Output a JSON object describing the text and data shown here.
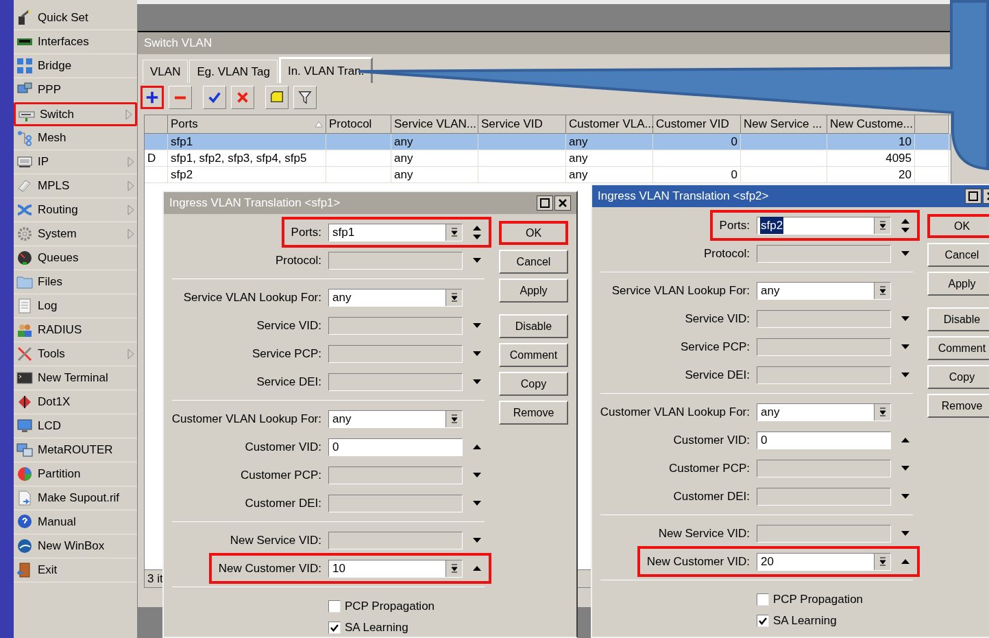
{
  "sidebar": {
    "items": [
      {
        "label": "Quick Set",
        "submenu": false,
        "highlighted": false
      },
      {
        "label": "Interfaces",
        "submenu": false,
        "highlighted": false
      },
      {
        "label": "Bridge",
        "submenu": false,
        "highlighted": false
      },
      {
        "label": "PPP",
        "submenu": false,
        "highlighted": false
      },
      {
        "label": "Switch",
        "submenu": true,
        "highlighted": true
      },
      {
        "label": "Mesh",
        "submenu": false,
        "highlighted": false
      },
      {
        "label": "IP",
        "submenu": true,
        "highlighted": false
      },
      {
        "label": "MPLS",
        "submenu": true,
        "highlighted": false
      },
      {
        "label": "Routing",
        "submenu": true,
        "highlighted": false
      },
      {
        "label": "System",
        "submenu": true,
        "highlighted": false
      },
      {
        "label": "Queues",
        "submenu": false,
        "highlighted": false
      },
      {
        "label": "Files",
        "submenu": false,
        "highlighted": false
      },
      {
        "label": "Log",
        "submenu": false,
        "highlighted": false
      },
      {
        "label": "RADIUS",
        "submenu": false,
        "highlighted": false
      },
      {
        "label": "Tools",
        "submenu": true,
        "highlighted": false
      },
      {
        "label": "New Terminal",
        "submenu": false,
        "highlighted": false
      },
      {
        "label": "Dot1X",
        "submenu": false,
        "highlighted": false
      },
      {
        "label": "LCD",
        "submenu": false,
        "highlighted": false
      },
      {
        "label": "MetaROUTER",
        "submenu": false,
        "highlighted": false
      },
      {
        "label": "Partition",
        "submenu": false,
        "highlighted": false
      },
      {
        "label": "Make Supout.rif",
        "submenu": false,
        "highlighted": false
      },
      {
        "label": "Manual",
        "submenu": false,
        "highlighted": false
      },
      {
        "label": "New WinBox",
        "submenu": false,
        "highlighted": false
      },
      {
        "label": "Exit",
        "submenu": false,
        "highlighted": false
      }
    ]
  },
  "window": {
    "title": "Switch VLAN",
    "tabs": [
      {
        "label": "VLAN",
        "selected": false,
        "highlighted": false
      },
      {
        "label": "Eg. VLAN Tag",
        "selected": false,
        "highlighted": false
      },
      {
        "label": "In. VLAN Tran.",
        "selected": true,
        "highlighted": true
      }
    ],
    "toolbar": [
      {
        "kind": "add",
        "highlighted": true
      },
      {
        "kind": "remove",
        "highlighted": false
      },
      {
        "kind": "enable",
        "highlighted": false
      },
      {
        "kind": "disable",
        "highlighted": false
      },
      {
        "kind": "comment",
        "highlighted": false
      },
      {
        "kind": "filter",
        "highlighted": false
      }
    ],
    "table": {
      "columns": [
        "",
        "Ports",
        "Protocol",
        "Service VLAN...",
        "Service VID",
        "Customer VLA...",
        "Customer VID",
        "New Service ...",
        "New Custome..."
      ],
      "rows": [
        {
          "selected": true,
          "cells": [
            "",
            "sfp1",
            "",
            "any",
            "",
            "any",
            "0",
            "",
            "10"
          ]
        },
        {
          "selected": false,
          "cells": [
            "D",
            "sfp1, sfp2, sfp3, sfp4, sfp5",
            "",
            "any",
            "",
            "any",
            "",
            "",
            "4095"
          ]
        },
        {
          "selected": false,
          "cells": [
            "",
            "sfp2",
            "",
            "any",
            "",
            "any",
            "0",
            "",
            "20"
          ]
        }
      ]
    },
    "status_bar": "3 it"
  },
  "dialogs": [
    {
      "title": "Ingress VLAN Translation <sfp1>",
      "active": false,
      "sections": [
        {
          "fields": [
            {
              "label": "Ports:",
              "value": "sfp1",
              "kind": "spin",
              "text_selected": false,
              "highlighted": true
            },
            {
              "label": "Protocol:",
              "kind": "select",
              "highlighted": false
            }
          ]
        },
        {
          "fields": [
            {
              "label": "Service VLAN Lookup For:",
              "value": "any",
              "kind": "combo",
              "text_selected": false,
              "highlighted": false
            },
            {
              "label": "Service VID:",
              "kind": "select",
              "highlighted": false
            },
            {
              "label": "Service PCP:",
              "kind": "select",
              "highlighted": false
            },
            {
              "label": "Service DEI:",
              "kind": "select",
              "highlighted": false
            }
          ]
        },
        {
          "fields": [
            {
              "label": "Customer VLAN Lookup For:",
              "value": "any",
              "kind": "combo",
              "text_selected": false,
              "highlighted": false
            },
            {
              "label": "Customer VID:",
              "value": "0",
              "kind": "counter",
              "text_selected": false,
              "highlighted": false
            },
            {
              "label": "Customer PCP:",
              "kind": "select",
              "highlighted": false
            },
            {
              "label": "Customer DEI:",
              "kind": "select",
              "highlighted": false
            }
          ]
        },
        {
          "fields": [
            {
              "label": "New Service VID:",
              "kind": "select",
              "highlighted": false
            },
            {
              "label": "New Customer VID:",
              "value": "10",
              "kind": "spinup",
              "text_selected": false,
              "highlighted": true
            }
          ]
        }
      ],
      "checkboxes": [
        {
          "label": "PCP Propagation",
          "checked": false
        },
        {
          "label": "SA Learning",
          "checked": true
        }
      ],
      "buttons": [
        {
          "label": "OK",
          "highlighted": true
        },
        {
          "label": "Cancel",
          "highlighted": false
        },
        {
          "label": "Apply",
          "highlighted": false
        },
        {
          "label": "Disable",
          "highlighted": false
        },
        {
          "label": "Comment",
          "highlighted": false
        },
        {
          "label": "Copy",
          "highlighted": false
        },
        {
          "label": "Remove",
          "highlighted": false
        }
      ]
    },
    {
      "title": "Ingress VLAN Translation <sfp2>",
      "active": true,
      "sections": [
        {
          "fields": [
            {
              "label": "Ports:",
              "value": "sfp2",
              "kind": "spin",
              "text_selected": true,
              "highlighted": true
            },
            {
              "label": "Protocol:",
              "kind": "select",
              "highlighted": false
            }
          ]
        },
        {
          "fields": [
            {
              "label": "Service VLAN Lookup For:",
              "value": "any",
              "kind": "combo",
              "text_selected": false,
              "highlighted": false
            },
            {
              "label": "Service VID:",
              "kind": "select",
              "highlighted": false
            },
            {
              "label": "Service PCP:",
              "kind": "select",
              "highlighted": false
            },
            {
              "label": "Service DEI:",
              "kind": "select",
              "highlighted": false
            }
          ]
        },
        {
          "fields": [
            {
              "label": "Customer VLAN Lookup For:",
              "value": "any",
              "kind": "combo",
              "text_selected": false,
              "highlighted": false
            },
            {
              "label": "Customer VID:",
              "value": "0",
              "kind": "counter",
              "text_selected": false,
              "highlighted": false
            },
            {
              "label": "Customer PCP:",
              "kind": "select",
              "highlighted": false
            },
            {
              "label": "Customer DEI:",
              "kind": "select",
              "highlighted": false
            }
          ]
        },
        {
          "fields": [
            {
              "label": "New Service VID:",
              "kind": "select",
              "highlighted": false
            },
            {
              "label": "New Customer VID:",
              "value": "20",
              "kind": "spinup",
              "text_selected": false,
              "highlighted": true
            }
          ]
        }
      ],
      "checkboxes": [
        {
          "label": "PCP Propagation",
          "checked": false
        },
        {
          "label": "SA Learning",
          "checked": true
        }
      ],
      "buttons": [
        {
          "label": "OK",
          "highlighted": true
        },
        {
          "label": "Cancel",
          "highlighted": false
        },
        {
          "label": "Apply",
          "highlighted": false
        },
        {
          "label": "Disable",
          "highlighted": false
        },
        {
          "label": "Comment",
          "highlighted": false
        },
        {
          "label": "Copy",
          "highlighted": false
        },
        {
          "label": "Remove",
          "highlighted": false
        }
      ]
    }
  ]
}
